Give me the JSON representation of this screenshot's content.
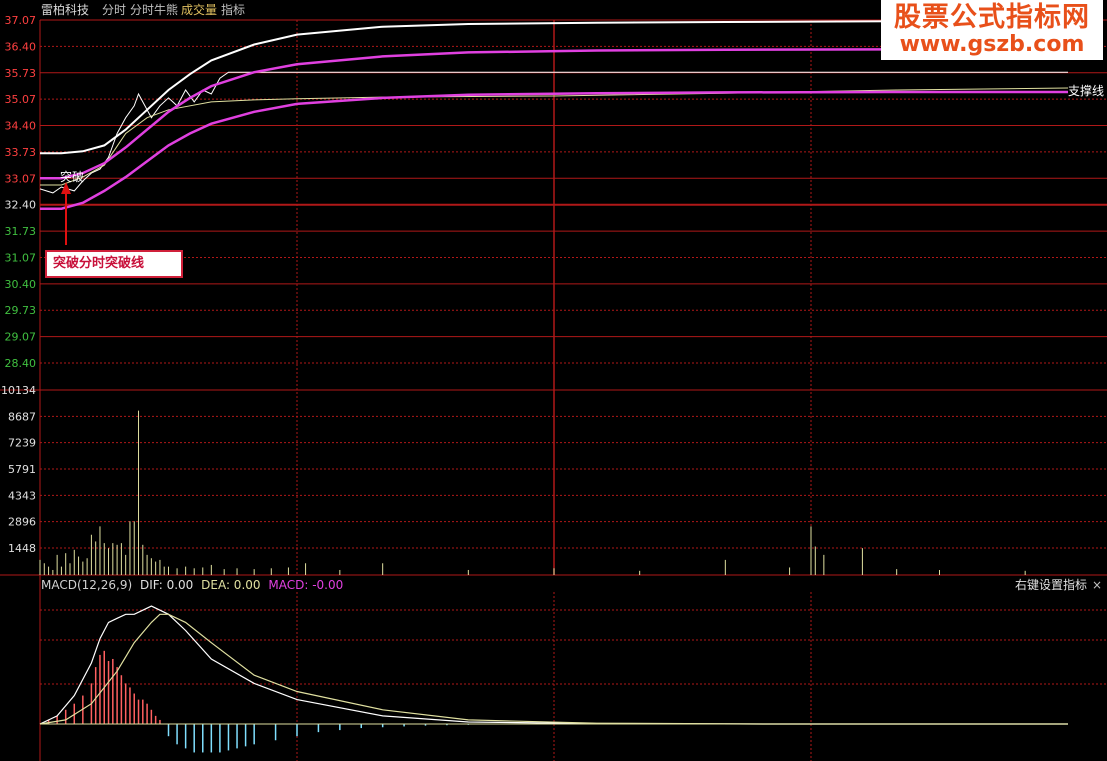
{
  "header": {
    "stock_name": "雷柏科技",
    "tabs": [
      "分时",
      "分时牛熊",
      "成交量",
      "指标"
    ],
    "tab_colors": [
      "#c0c0c0",
      "#c0c0c0",
      "#e0c060",
      "#c0c0c0"
    ]
  },
  "watermark": {
    "line1": "股票公式指标网",
    "line2": "www.gszb.com"
  },
  "annotations": {
    "breakout_label": "突破",
    "callout_text": "突破分时突破线",
    "support_label": "支撑线"
  },
  "macd_header": {
    "name": "MACD(12,26,9)",
    "dif": "DIF: 0.00",
    "dea": "DEA: 0.00",
    "macd": "MACD: -0.00",
    "right_label": "右键设置指标",
    "close_glyph": "×"
  },
  "colors": {
    "grid": "#b01818",
    "axis_up": "#ff4040",
    "axis_down": "#40c040",
    "price": "#ffffff",
    "avg": "#e0e0a0",
    "magenta": "#e040e0",
    "volume": "#e0e0a0",
    "macd_pos": "#ff6060",
    "macd_neg": "#80e0ff"
  },
  "chart_data": [
    {
      "type": "line",
      "title": "",
      "ylim": [
        28.4,
        37.07
      ],
      "y_ticks": [
        "37.07",
        "36.40",
        "35.73",
        "35.07",
        "34.40",
        "33.73",
        "33.07",
        "32.40",
        "31.73",
        "31.07",
        "30.40",
        "29.73",
        "29.07",
        "28.40"
      ],
      "reference_price": 32.4,
      "x_range": [
        0,
        240
      ],
      "series": [
        {
          "values_x": [
            0,
            3,
            5,
            8,
            10,
            12,
            14,
            16,
            18,
            20,
            22,
            23,
            24,
            26,
            28,
            30,
            32,
            34,
            36,
            38,
            40,
            42,
            44,
            46,
            48,
            50,
            60,
            240
          ],
          "values_y": [
            32.8,
            32.7,
            32.85,
            32.75,
            33.0,
            33.2,
            33.3,
            33.6,
            34.2,
            34.6,
            34.9,
            35.2,
            35.0,
            34.6,
            34.9,
            35.1,
            34.9,
            35.3,
            35.0,
            35.3,
            35.2,
            35.6,
            35.75,
            35.75,
            35.75,
            35.75,
            35.75,
            35.75
          ]
        },
        {
          "values_x": [
            0,
            5,
            10,
            15,
            20,
            25,
            30,
            40,
            50,
            60,
            80,
            120,
            160,
            200,
            240
          ],
          "values_y": [
            32.9,
            32.9,
            33.1,
            33.4,
            34.2,
            34.6,
            34.8,
            35.0,
            35.05,
            35.08,
            35.12,
            35.15,
            35.22,
            35.3,
            35.35
          ]
        },
        {
          "values_x": [
            0,
            5,
            10,
            15,
            20,
            25,
            30,
            35,
            40,
            50,
            60,
            80,
            100,
            130,
            160,
            200,
            240
          ],
          "values_y": [
            33.7,
            33.7,
            33.75,
            33.9,
            34.3,
            34.8,
            35.3,
            35.7,
            36.05,
            36.45,
            36.7,
            36.9,
            36.97,
            37.0,
            37.02,
            37.04,
            37.05
          ]
        },
        {
          "values_x": [
            0,
            5,
            10,
            15,
            20,
            25,
            30,
            35,
            40,
            50,
            60,
            80,
            100,
            130,
            160,
            200,
            240
          ],
          "values_y": [
            33.07,
            33.07,
            33.2,
            33.45,
            33.85,
            34.3,
            34.75,
            35.1,
            35.4,
            35.75,
            35.95,
            36.15,
            36.25,
            36.3,
            36.32,
            36.33,
            36.33
          ]
        },
        {
          "values_x": [
            0,
            5,
            10,
            15,
            20,
            25,
            30,
            35,
            40,
            50,
            60,
            80,
            100,
            130,
            160,
            200,
            240
          ],
          "values_y": [
            32.3,
            32.3,
            32.45,
            32.75,
            33.1,
            33.5,
            33.9,
            34.2,
            34.45,
            34.75,
            34.95,
            35.1,
            35.18,
            35.22,
            35.24,
            35.25,
            35.25
          ]
        }
      ]
    },
    {
      "type": "bar",
      "title": "成交量",
      "ylim": [
        0,
        10134
      ],
      "y_ticks": [
        "10134",
        "8687",
        "7239",
        "5791",
        "4343",
        "2896",
        "1448"
      ],
      "values_x": [
        0,
        1,
        2,
        3,
        4,
        5,
        6,
        7,
        8,
        9,
        10,
        11,
        12,
        13,
        14,
        15,
        16,
        17,
        18,
        19,
        20,
        21,
        22,
        23,
        24,
        25,
        26,
        27,
        28,
        29,
        30,
        32,
        34,
        36,
        38,
        40,
        43,
        46,
        50,
        54,
        58,
        62,
        70,
        80,
        100,
        120,
        140,
        160,
        175,
        180,
        181,
        183,
        192,
        200,
        210,
        230
      ],
      "values": [
        900,
        700,
        500,
        300,
        1200,
        500,
        1300,
        700,
        1500,
        1100,
        800,
        1000,
        2400,
        2000,
        2900,
        1900,
        1600,
        1900,
        1800,
        1900,
        1200,
        3200,
        3200,
        9800,
        1800,
        1200,
        1000,
        800,
        900,
        500,
        500,
        400,
        500,
        400,
        450,
        600,
        350,
        400,
        350,
        400,
        450,
        700,
        300,
        700,
        300,
        400,
        250,
        900,
        450,
        2900,
        1700,
        1200,
        1600,
        350,
        300,
        250
      ]
    },
    {
      "type": "area",
      "title": "MACD(12,26,9)",
      "ylim": [
        -0.09,
        0.31
      ],
      "dif_x": [
        0,
        4,
        8,
        12,
        14,
        16,
        18,
        20,
        22,
        24,
        26,
        30,
        34,
        40,
        50,
        60,
        80,
        100,
        130,
        170,
        240
      ],
      "dif_y": [
        0,
        0.02,
        0.07,
        0.15,
        0.21,
        0.25,
        0.26,
        0.27,
        0.27,
        0.28,
        0.29,
        0.27,
        0.23,
        0.16,
        0.1,
        0.06,
        0.02,
        0.005,
        0.001,
        0.0,
        0.0
      ],
      "dea_x": [
        0,
        6,
        12,
        18,
        22,
        26,
        28,
        30,
        34,
        40,
        50,
        60,
        80,
        100,
        130,
        170,
        240
      ],
      "dea_y": [
        0,
        0.01,
        0.05,
        0.13,
        0.2,
        0.25,
        0.27,
        0.27,
        0.25,
        0.2,
        0.12,
        0.08,
        0.035,
        0.01,
        0.002,
        0.0,
        0.0
      ],
      "hist_x": [
        2,
        4,
        6,
        8,
        10,
        12,
        13,
        14,
        15,
        16,
        17,
        18,
        19,
        20,
        21,
        22,
        23,
        24,
        25,
        26,
        27,
        28,
        30,
        32,
        34,
        36,
        38,
        40,
        42,
        44,
        46,
        48,
        50,
        55,
        60,
        65,
        70,
        75,
        80,
        85,
        90,
        95,
        100
      ],
      "hist_y": [
        0.01,
        0.02,
        0.035,
        0.05,
        0.07,
        0.1,
        0.14,
        0.17,
        0.18,
        0.155,
        0.16,
        0.14,
        0.12,
        0.1,
        0.09,
        0.075,
        0.06,
        0.06,
        0.05,
        0.035,
        0.02,
        0.01,
        -0.03,
        -0.05,
        -0.06,
        -0.07,
        -0.07,
        -0.07,
        -0.07,
        -0.065,
        -0.06,
        -0.055,
        -0.05,
        -0.04,
        -0.03,
        -0.02,
        -0.015,
        -0.01,
        -0.008,
        -0.006,
        -0.004,
        -0.003,
        -0.002
      ]
    }
  ]
}
